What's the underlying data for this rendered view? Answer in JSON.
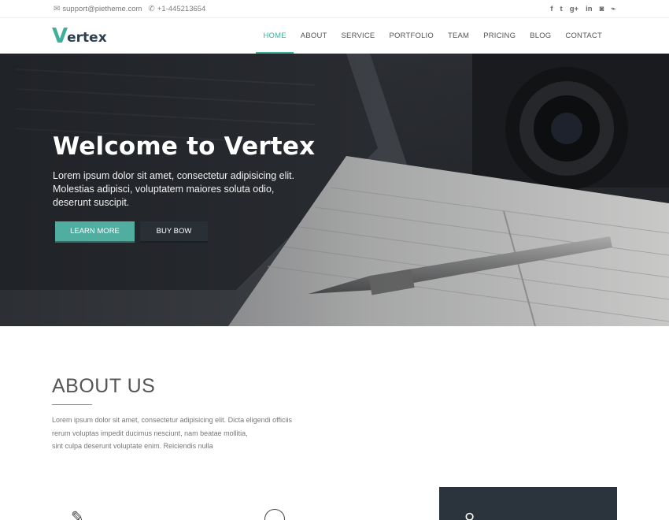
{
  "topbar": {
    "email": "support@pietheme.com",
    "phone": "+1-445213654",
    "icons": [
      "envelope-icon",
      "phone-icon"
    ],
    "social": [
      {
        "name": "facebook-icon",
        "glyph": "f"
      },
      {
        "name": "twitter-icon",
        "glyph": "t"
      },
      {
        "name": "google-plus-icon",
        "glyph": "g+"
      },
      {
        "name": "linkedin-icon",
        "glyph": "in"
      },
      {
        "name": "instagram-icon",
        "glyph": "◙"
      },
      {
        "name": "rss-icon",
        "glyph": "⌁"
      }
    ]
  },
  "header": {
    "logo_first": "V",
    "logo_rest": "ertex",
    "nav": [
      "HOME",
      "ABOUT",
      "SERVICE",
      "PORTFOLIO",
      "TEAM",
      "PRICING",
      "BLOG",
      "CONTACT"
    ],
    "active": "HOME"
  },
  "hero": {
    "title": "Welcome to Vertex",
    "text": "Lorem ipsum dolor sit amet, consectetur adipisicing elit. Molestias adipisci, voluptatem maiores soluta odio, deserunt suscipit.",
    "learn_label": "LEARN MORE",
    "buy_label": "BUY BOW"
  },
  "about": {
    "title": "ABOUT US",
    "text_lines": [
      "Lorem ipsum dolor sit amet, consectetur adipisicing elit. Dicta eligendi officiis",
      "rerum voluptas impedit ducimus nesciunt, nam beatae mollitia,",
      "sint culpa deserunt voluptate enim. Reiciendis nulla"
    ]
  },
  "colors": {
    "accent": "#3daf9a",
    "dark": "#283036"
  }
}
